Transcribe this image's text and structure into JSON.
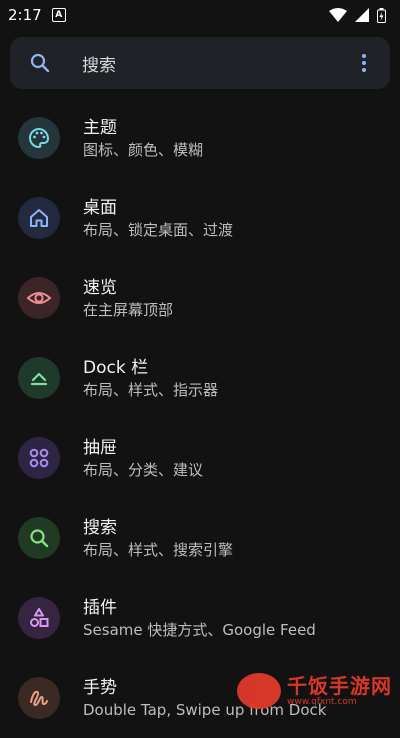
{
  "status_bar": {
    "time": "2:17",
    "notification_glyph": "A",
    "icons": [
      "wifi-icon",
      "signal-icon",
      "battery-icon"
    ]
  },
  "search": {
    "placeholder": "搜索",
    "icon": "search-icon",
    "menu_icon": "more-vert-icon"
  },
  "items": [
    {
      "title": "主题",
      "subtitle": "图标、颜色、模糊",
      "icon": "palette-icon",
      "icon_bg": "#23363b",
      "icon_color": "#7fd6e5"
    },
    {
      "title": "桌面",
      "subtitle": "布局、锁定桌面、过渡",
      "icon": "home-icon",
      "icon_bg": "#23293e",
      "icon_color": "#8fb2f5"
    },
    {
      "title": "速览",
      "subtitle": "在主屏幕顶部",
      "icon": "eye-icon",
      "icon_bg": "#3b2527",
      "icon_color": "#ef8d95"
    },
    {
      "title": "Dock 栏",
      "subtitle": "布局、样式、指示器",
      "icon": "dock-icon",
      "icon_bg": "#1f3a2b",
      "icon_color": "#7fe0a0"
    },
    {
      "title": "抽屉",
      "subtitle": "布局、分类、建议",
      "icon": "grid-icon",
      "icon_bg": "#2e2545",
      "icon_color": "#a98df0"
    },
    {
      "title": "搜索",
      "subtitle": "布局、样式、搜索引擎",
      "icon": "search-icon",
      "icon_bg": "#213a23",
      "icon_color": "#86e07f"
    },
    {
      "title": "插件",
      "subtitle": "Sesame 快捷方式、Google Feed",
      "icon": "shapes-icon",
      "icon_bg": "#372440",
      "icon_color": "#d89af0"
    },
    {
      "title": "手势",
      "subtitle": "Double Tap, Swipe up from Dock",
      "icon": "gesture-icon",
      "icon_bg": "#3b2a24",
      "icon_color": "#eba07e"
    }
  ],
  "watermark": {
    "title": "千饭手游网",
    "url": "www.qfxnt.com"
  }
}
